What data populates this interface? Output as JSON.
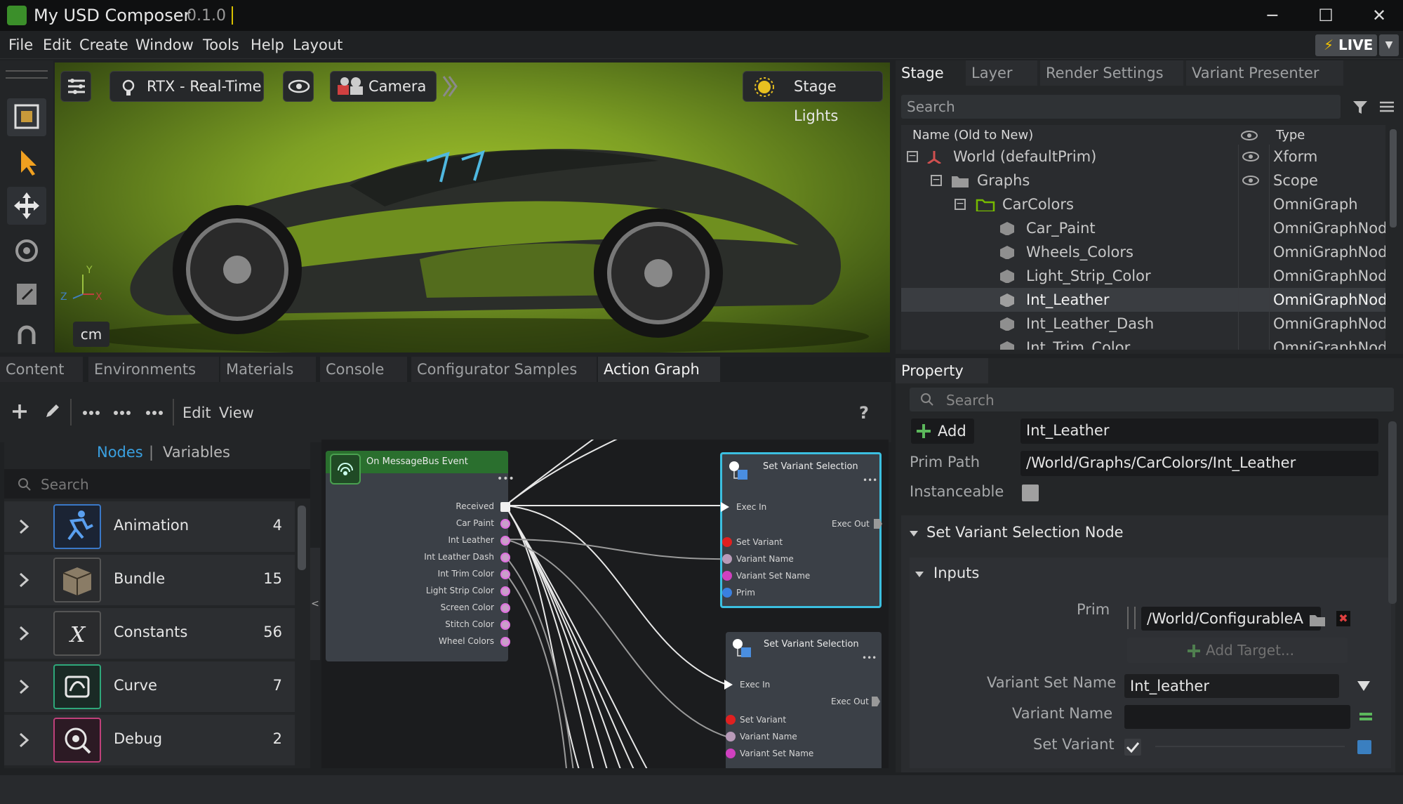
{
  "window": {
    "title": "My USD Composer",
    "version": "0.1.0",
    "controls": [
      "─",
      "☐",
      "✕"
    ]
  },
  "menu": [
    "File",
    "Edit",
    "Create",
    "Window",
    "Tools",
    "Help",
    "Layout"
  ],
  "live": {
    "label": "LIVE"
  },
  "viewport": {
    "render_mode": "RTX - Real-Time",
    "camera": "Camera",
    "stage_lights": "Stage Lights",
    "units": "cm",
    "axes": {
      "y": "Y",
      "z": "Z",
      "x": "X"
    }
  },
  "stage_panel": {
    "tabs": [
      "Stage",
      "Layer",
      "Render Settings",
      "Variant Presenter"
    ],
    "search_placeholder": "Search",
    "columns": {
      "name": "Name (Old to New)",
      "type": "Type"
    },
    "rows": [
      {
        "name": "World (defaultPrim)",
        "type": "Xform"
      },
      {
        "name": "Graphs",
        "type": "Scope"
      },
      {
        "name": "CarColors",
        "type": "OmniGraph"
      },
      {
        "name": "Car_Paint",
        "type": "OmniGraphNod"
      },
      {
        "name": "Wheels_Colors",
        "type": "OmniGraphNod"
      },
      {
        "name": "Light_Strip_Color",
        "type": "OmniGraphNod"
      },
      {
        "name": "Int_Leather",
        "type": "OmniGraphNod"
      },
      {
        "name": "Int_Leather_Dash",
        "type": "OmniGraphNod"
      },
      {
        "name": "Int_Trim_Color",
        "type": "OmniGraphNod"
      }
    ]
  },
  "bottom_tabs": [
    "Content",
    "Environments",
    "Materials",
    "Console",
    "Configurator Samples",
    "Action Graph"
  ],
  "action_graph": {
    "menu": {
      "edit": "Edit",
      "view": "View",
      "help": "?"
    },
    "library_tabs": {
      "nodes": "Nodes",
      "separator": "|",
      "variables": "Variables"
    },
    "search_placeholder": "Search",
    "collapse_glyph": "<",
    "categories": [
      {
        "label": "Animation",
        "count": "4"
      },
      {
        "label": "Bundle",
        "count": "15"
      },
      {
        "label": "Constants",
        "count": "56"
      },
      {
        "label": "Curve",
        "count": "7"
      },
      {
        "label": "Debug",
        "count": "2"
      }
    ],
    "event_node": {
      "title": "On MessageBus Event",
      "ports": [
        "Received",
        "Car Paint",
        "Int Leather",
        "Int Leather Dash",
        "Int Trim Color",
        "Light Strip Color",
        "Screen Color",
        "Stitch Color",
        "Wheel Colors"
      ]
    },
    "variant_node_1": {
      "title": "Set Variant Selection",
      "exec_in": "Exec In",
      "exec_out": "Exec Out",
      "ports": [
        "Set Variant",
        "Variant Name",
        "Variant Set Name",
        "Prim"
      ]
    },
    "variant_node_2": {
      "title": "Set Variant Selection",
      "exec_in": "Exec In",
      "exec_out": "Exec Out",
      "ports": [
        "Set Variant",
        "Variant Name",
        "Variant Set Name"
      ]
    }
  },
  "property": {
    "tab": "Property",
    "search_placeholder": "Search",
    "add_label": "Add",
    "name_value": "Int_Leather",
    "prim_path_label": "Prim Path",
    "prim_path_value": "/World/Graphs/CarColors/Int_Leather",
    "instanceable_label": "Instanceable",
    "section": "Set Variant Selection Node",
    "inputs_label": "Inputs",
    "prim_label": "Prim",
    "prim_value": "/World/ConfigurableA",
    "add_target": "Add Target...",
    "variant_set_name_label": "Variant Set Name",
    "variant_set_name_value": "Int_leather",
    "variant_name_label": "Variant Name",
    "variant_name_value": "",
    "set_variant_label": "Set Variant"
  },
  "colors": {
    "accent_live": "#f2c200",
    "selection_blue": "#3bbfe0",
    "green": "#76b900"
  }
}
